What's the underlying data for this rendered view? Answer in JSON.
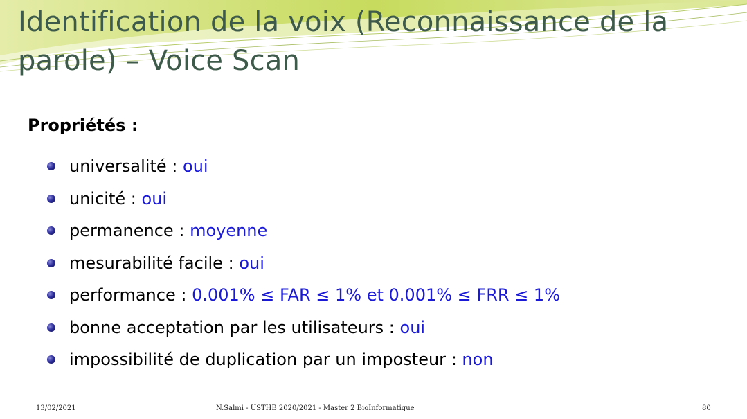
{
  "slide": {
    "title": "Identification de la voix (Reconnaissance de la parole) – Voice Scan",
    "section_heading": "Propriétés :",
    "properties": [
      {
        "label": "universalité",
        "separator": ":",
        "value": "oui"
      },
      {
        "label": "unicité",
        "separator": ":",
        "value": "oui"
      },
      {
        "label": "permanence",
        "separator": ":",
        "value": "moyenne"
      },
      {
        "label": "mesurabilité facile",
        "separator": ":",
        "value": "oui"
      },
      {
        "label": "performance",
        "separator": ":",
        "value": "0.001% ≤ FAR ≤ 1% et 0.001% ≤ FRR ≤ 1%"
      },
      {
        "label": "bonne acceptation par les utilisateurs",
        "separator": ":",
        "value": "oui"
      },
      {
        "label": "impossibilité de duplication par un imposteur",
        "separator": ":",
        "value": "non"
      }
    ]
  },
  "footer": {
    "date": "13/02/2021",
    "center": "N.Salmi - USTHB 2020/2021 - Master 2 BioInformatique",
    "page_number": "80"
  },
  "colors": {
    "title": "#3d5a4a",
    "value_text": "#1a1ad6",
    "bullet": "#2f2f9e",
    "deco_green": "#c9dc6a"
  }
}
